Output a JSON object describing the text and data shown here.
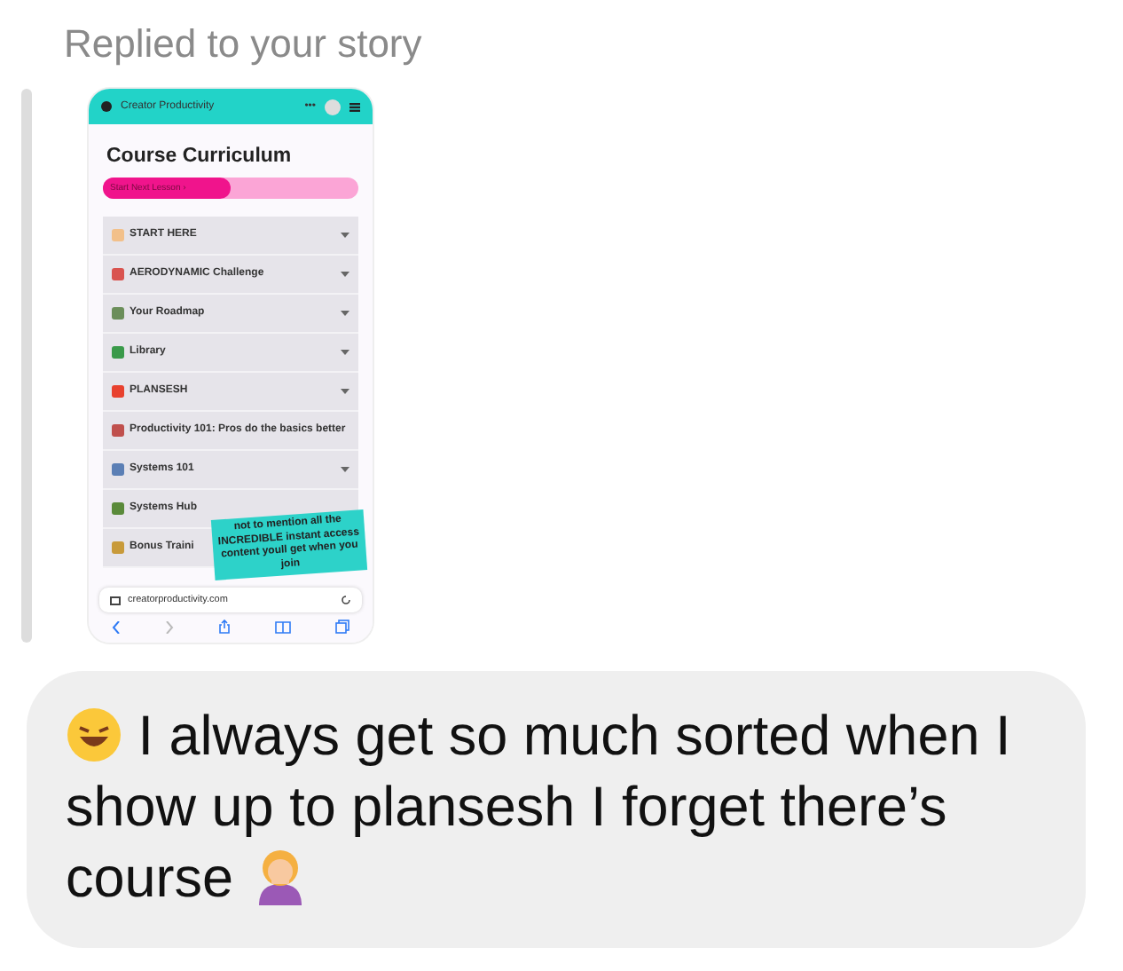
{
  "reply_label": "Replied to your story",
  "story": {
    "site_name": "Creator Productivity",
    "menu_glyph": "•••",
    "heading": "Course Curriculum",
    "progress_button": "Start Next Lesson  ›",
    "level": 0.5,
    "modules": [
      {
        "label": "START HERE",
        "chevron": true
      },
      {
        "label": "AERODYNAMIC Challenge",
        "chevron": true
      },
      {
        "label": "Your Roadmap",
        "chevron": true
      },
      {
        "label": "Library",
        "chevron": true
      },
      {
        "label": "PLANSESH",
        "chevron": true
      },
      {
        "label": "Productivity 101: Pros do the basics better",
        "chevron": false
      },
      {
        "label": "Systems 101",
        "chevron": true
      },
      {
        "label": "Systems Hub"
      },
      {
        "label": "Bonus Traini"
      }
    ],
    "sticker": "not to mention all the INCREDIBLE instant access content youll get when you join",
    "url": "creatorproductivity.com"
  },
  "message": {
    "text": "I always get so much sorted when I show up to plansesh I forget there’s course"
  }
}
